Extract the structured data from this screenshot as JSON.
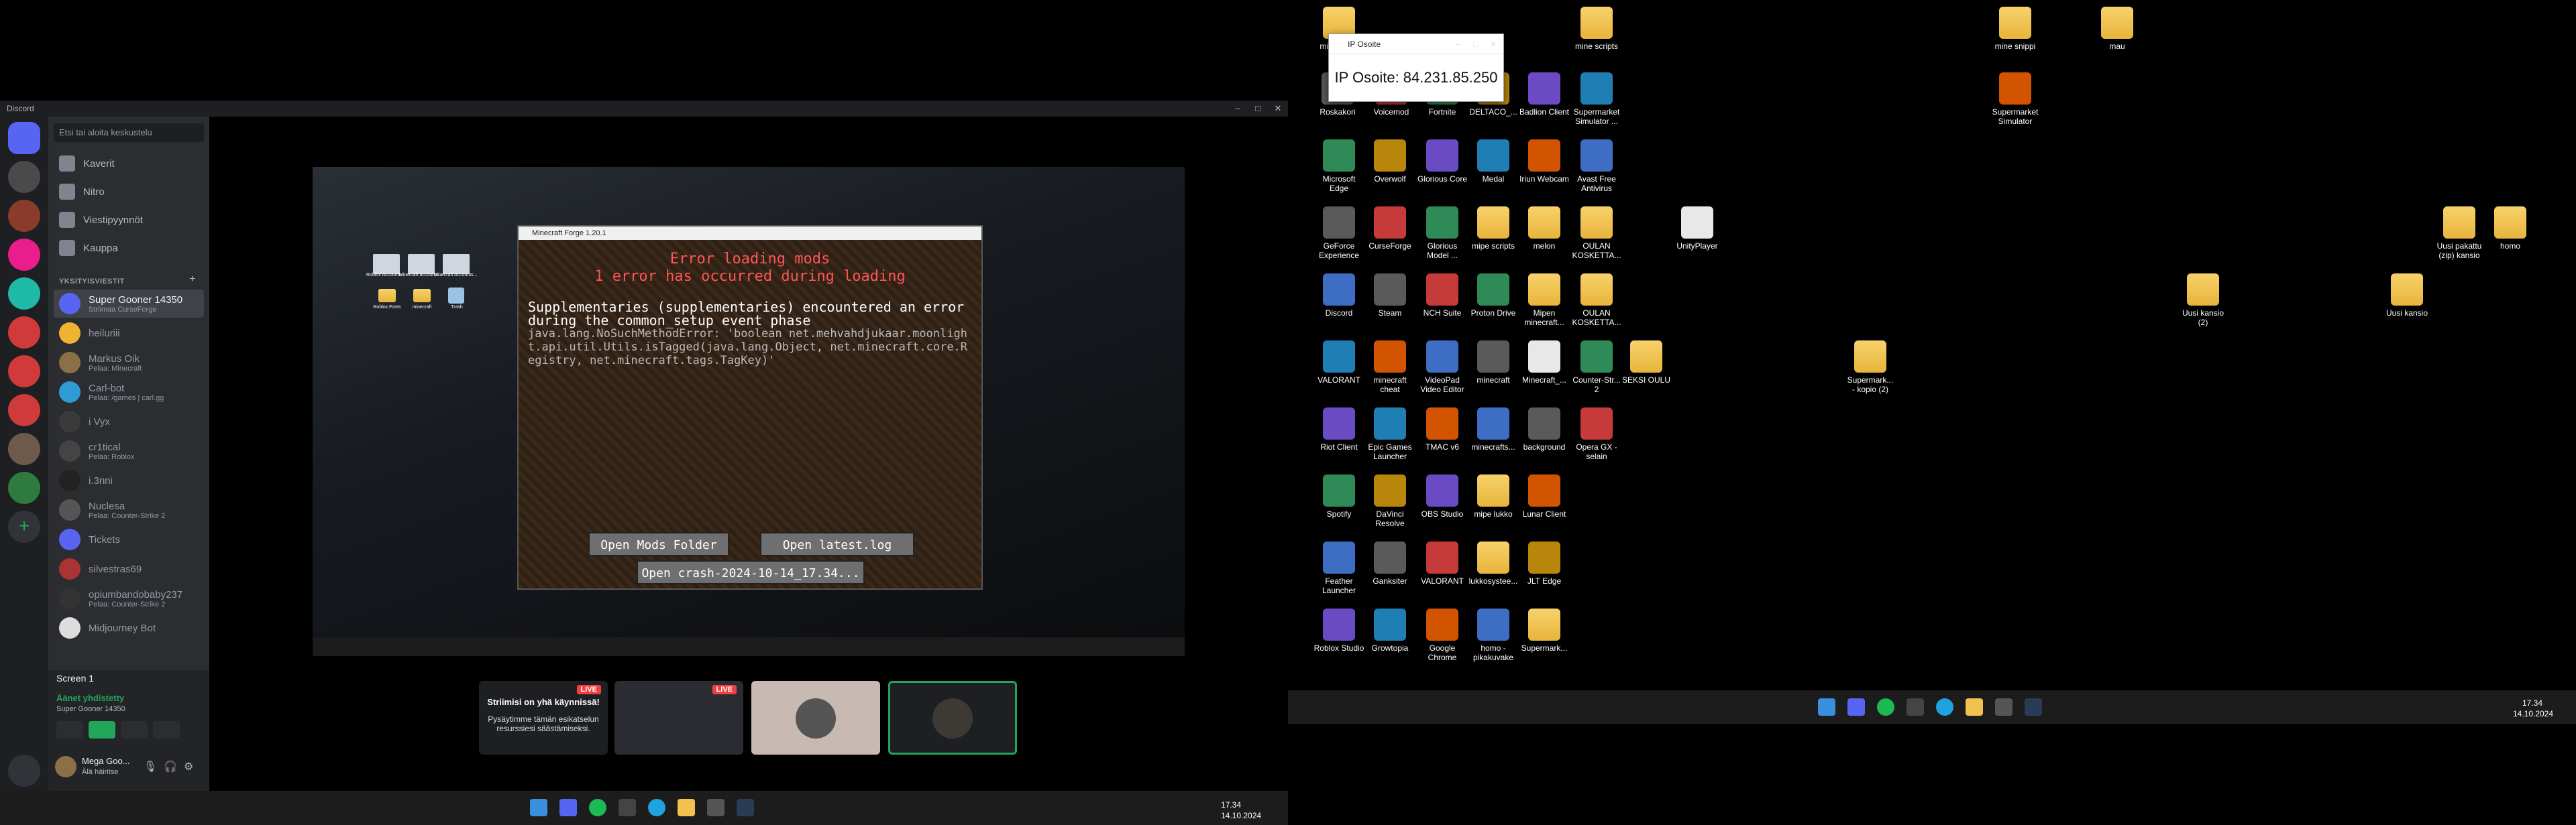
{
  "left_monitor": {
    "discord": {
      "window_title": "Discord",
      "search_placeholder": "Etsi tai aloita keskustelu",
      "nav": [
        "Kaverit",
        "Nitro",
        "Viestipyynnöt",
        "Kauppa"
      ],
      "dm_header": "YKSITYISVIESTIT",
      "dm_plus": "+",
      "dms": [
        {
          "name": "Super Gooner 14350",
          "status": "Striimaa CurseForge",
          "color": "#5865f2"
        },
        {
          "name": "heiluriii",
          "status": "",
          "color": "#f0b232"
        },
        {
          "name": "Markus Oik",
          "status": "Pelaa: Minecraft",
          "color": "#8b6f47"
        },
        {
          "name": "Carl-bot",
          "status": "Pelaa: /games | carl.gg",
          "color": "#2e9bd6"
        },
        {
          "name": "i Vyx",
          "status": "",
          "color": "#3a3a3a"
        },
        {
          "name": "cr1tical",
          "status": "Pelaa: Roblox",
          "color": "#444"
        },
        {
          "name": "i.3nni",
          "status": "",
          "color": "#222"
        },
        {
          "name": "Nuclesa",
          "status": "Pelaa: Counter-Strike 2",
          "color": "#555"
        },
        {
          "name": "Tickets",
          "status": "",
          "color": "#5865f2"
        },
        {
          "name": "silvestras69",
          "status": "",
          "color": "#a33"
        },
        {
          "name": "opiumbandobaby237",
          "status": "Pelaa: Counter-Strike 2",
          "color": "#333"
        },
        {
          "name": "Midjourney Bot",
          "status": "",
          "color": "#ddd"
        }
      ],
      "voice": {
        "screen_label": "Screen 1",
        "connected": "Äänet yhdistetty",
        "channel": "Super Gooner 14350"
      },
      "user": {
        "name": "Mega Goo...",
        "status": "Älä häiritse"
      },
      "stream": {
        "minecraft": {
          "window_title": "Minecraft Forge 1.20.1",
          "error_title": "Error loading mods",
          "error_sub": "1 error has occurred during loading",
          "message": "Supplementaries (supplementaries) encountered an error during the common_setup event phase",
          "detail": "java.lang.NoSuchMethodError: 'boolean net.mehvahdjukaar.moonlight.api.util.Utils.isTagged(java.lang.Object, net.minecraft.core.Registry, net.minecraft.tags.TagKey)'",
          "btn_mods": "Open Mods Folder",
          "btn_log": "Open latest.log",
          "btn_crash": "Open crash-2024-10-14_17.34..."
        },
        "desktop_icons": [
          "Roblox Accounts...",
          "Minecraft accounts...",
          "Minecraft Accounts...",
          "Roblox Fonts",
          "minecraft",
          "Trash"
        ],
        "thumb1_title": "Striimisi on yhä käynnissä!",
        "thumb1_text": "Pysäytimme tämän esikatselun resurssiesi säästämiseksi.",
        "live_label": "LIVE"
      }
    },
    "taskbar": {
      "time": "17.34",
      "date": "14.10.2024"
    }
  },
  "right_monitor": {
    "ip_window": {
      "title": "IP Osoite",
      "text": "IP Osoite: 84.231.85.250"
    },
    "icons": [
      {
        "label": "mipe lukko",
        "kind": "folder"
      },
      {
        "label": "Roskakori",
        "kind": "app"
      },
      {
        "label": "Voicemod",
        "kind": "app"
      },
      {
        "label": "Fortnite",
        "kind": "app"
      },
      {
        "label": "DELTACO_...",
        "kind": "app"
      },
      {
        "label": "Badlion Client",
        "kind": "app"
      },
      {
        "label": "Supermarket Simulator ...",
        "kind": "app"
      },
      {
        "label": "Supermarket Simulator",
        "kind": "app"
      },
      {
        "label": "mine scripts",
        "kind": "folder"
      },
      {
        "label": "mine snippi",
        "kind": "folder"
      },
      {
        "label": "mau",
        "kind": "folder"
      },
      {
        "label": "Microsoft Edge",
        "kind": "app"
      },
      {
        "label": "Overwolf",
        "kind": "app"
      },
      {
        "label": "Glorious Core",
        "kind": "app"
      },
      {
        "label": "Medal",
        "kind": "app"
      },
      {
        "label": "Iriun Webcam",
        "kind": "app"
      },
      {
        "label": "Avast Free Antivirus",
        "kind": "app"
      },
      {
        "label": "GeForce Experience",
        "kind": "app"
      },
      {
        "label": "CurseForge",
        "kind": "app"
      },
      {
        "label": "Glorious Model ...",
        "kind": "app"
      },
      {
        "label": "mipe scripts",
        "kind": "folder"
      },
      {
        "label": "melon",
        "kind": "folder"
      },
      {
        "label": "OULAN KOSKETTA...",
        "kind": "folder"
      },
      {
        "label": "UnityPlayer",
        "kind": "file"
      },
      {
        "label": "Discord",
        "kind": "app"
      },
      {
        "label": "Steam",
        "kind": "app"
      },
      {
        "label": "NCH Suite",
        "kind": "app"
      },
      {
        "label": "Proton Drive",
        "kind": "app"
      },
      {
        "label": "Mipen minecraft...",
        "kind": "folder"
      },
      {
        "label": "OULAN KOSKETTA...",
        "kind": "folder"
      },
      {
        "label": "VALORANT",
        "kind": "app"
      },
      {
        "label": "minecraft cheat",
        "kind": "app"
      },
      {
        "label": "VideoPad Video Editor",
        "kind": "app"
      },
      {
        "label": "minecraft",
        "kind": "app"
      },
      {
        "label": "Minecraft_...",
        "kind": "file"
      },
      {
        "label": "Counter-Str... 2",
        "kind": "app"
      },
      {
        "label": "SEKSI OULU",
        "kind": "folder"
      },
      {
        "label": "Riot Client",
        "kind": "app"
      },
      {
        "label": "Epic Games Launcher",
        "kind": "app"
      },
      {
        "label": "TMAC v6",
        "kind": "app"
      },
      {
        "label": "minecrafts...",
        "kind": "app"
      },
      {
        "label": "background",
        "kind": "app"
      },
      {
        "label": "Opera GX -selain",
        "kind": "app"
      },
      {
        "label": "Spotify",
        "kind": "app"
      },
      {
        "label": "DaVinci Resolve",
        "kind": "app"
      },
      {
        "label": "OBS Studio",
        "kind": "app"
      },
      {
        "label": "mipe lukko",
        "kind": "folder"
      },
      {
        "label": "Lunar Client",
        "kind": "app"
      },
      {
        "label": "Feather Launcher",
        "kind": "app"
      },
      {
        "label": "Ganksiter",
        "kind": "app"
      },
      {
        "label": "VALORANT",
        "kind": "app"
      },
      {
        "label": "lukkosystee...",
        "kind": "folder"
      },
      {
        "label": "JLT Edge",
        "kind": "app"
      },
      {
        "label": "Roblox Studio",
        "kind": "app"
      },
      {
        "label": "Growtopia",
        "kind": "app"
      },
      {
        "label": "Google Chrome",
        "kind": "app"
      },
      {
        "label": "homo - pikakuvake",
        "kind": "app"
      },
      {
        "label": "Supermark...",
        "kind": "folder"
      },
      {
        "label": "Uusi kansio (2)",
        "kind": "folder"
      },
      {
        "label": "Uusi kansio",
        "kind": "folder"
      },
      {
        "label": "Supermark... - kopio (2)",
        "kind": "folder"
      },
      {
        "label": "Uusi pakattu (zip) kansio",
        "kind": "folder"
      },
      {
        "label": "homo",
        "kind": "folder"
      }
    ],
    "taskbar": {
      "time": "17.34",
      "date": "14.10.2024"
    }
  }
}
